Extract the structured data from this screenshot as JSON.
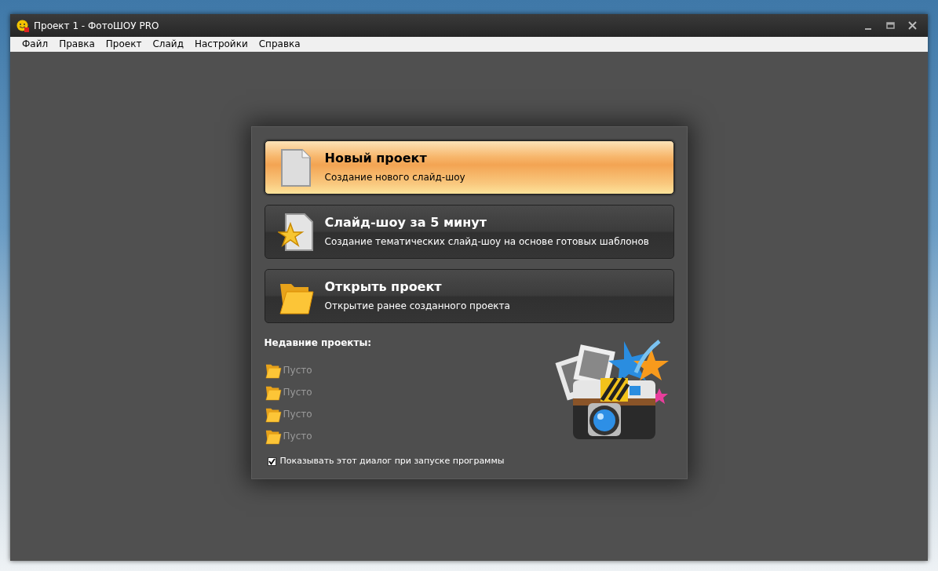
{
  "window": {
    "title": "Проект 1 - ФотоШОУ PRO"
  },
  "menu": [
    "Файл",
    "Правка",
    "Проект",
    "Слайд",
    "Настройки",
    "Справка"
  ],
  "actions": [
    {
      "kind": "new",
      "title": "Новый проект",
      "description": "Создание нового слайд-шоу",
      "selected": true
    },
    {
      "kind": "template",
      "title": "Слайд-шоу за 5 минут",
      "description": "Создание тематических слайд-шоу на основе готовых шаблонов",
      "selected": false
    },
    {
      "kind": "open",
      "title": "Открыть проект",
      "description": "Открытие ранее созданного проекта",
      "selected": false
    }
  ],
  "recent": {
    "heading": "Недавние проекты:",
    "items": [
      "Пусто",
      "Пусто",
      "Пусто",
      "Пусто"
    ]
  },
  "startup_checkbox": {
    "label": "Показывать этот диалог при запуске программы",
    "checked": true
  }
}
